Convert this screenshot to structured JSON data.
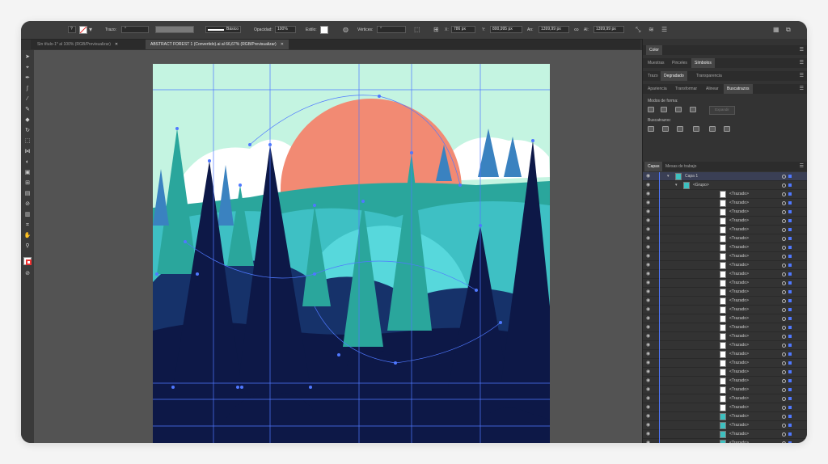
{
  "control_bar": {
    "stroke_label": "Trazo:",
    "brush_label": "Básico",
    "opacity_label": "Opacidad:",
    "opacity_value": "100%",
    "style_label": "Estilo:",
    "vertices_label": "Vértices:",
    "x_value": "786 px",
    "y_value": "800,995 px",
    "w_label": "An:",
    "w_value": "1399,99 px",
    "h_label": "Al:",
    "h_value": "1399,99 px",
    "icons": [
      "group-icon",
      "stroke-swatch-icon",
      "fill-swatch-icon",
      "globe-icon",
      "align-icon",
      "transform-icon",
      "link-icon",
      "isolate-icon",
      "arrange-icon",
      "panel-toggle-icon"
    ]
  },
  "document_tabs": [
    {
      "label": "Sin título-1* al 100% (RGB/Previsualizar)",
      "active": false
    },
    {
      "label": "ABSTRACT FOREST 1 (Convertido).ai al 66,67% (RGB/Previsualizar)",
      "active": true
    }
  ],
  "tools": [
    "selection-tool-icon",
    "direct-selection-tool-icon",
    "pen-tool-icon",
    "curvature-tool-icon",
    "paintbrush-tool-icon",
    "pencil-tool-icon",
    "eraser-tool-icon",
    "rotate-tool-icon",
    "scale-tool-icon",
    "width-tool-icon",
    "shape-builder-tool-icon",
    "perspective-tool-icon",
    "mesh-tool-icon",
    "gradient-tool-icon",
    "eyedropper-tool-icon",
    "chart-tool-icon",
    "artboard-tool-icon",
    "hand-tool-icon",
    "zoom-tool-icon",
    "fill-stroke-icon",
    "swap-colors-icon",
    "color-mode-icon"
  ],
  "panels": {
    "color_title": "Color",
    "row1_tabs": [
      "Muestras",
      "Pinceles",
      "Símbolos"
    ],
    "row1_active": 2,
    "row2_tabs": [
      "Trazo",
      "Degradado",
      "Transparencia"
    ],
    "row2_active": 1,
    "row3_tabs": [
      "Apariencia",
      "Transformar",
      "Alinear",
      "Buscatrazos"
    ],
    "row3_active": 3,
    "shape_modes_label": "Modos de forma:",
    "expand_label": "Expandir",
    "pathfinders_label": "Buscatrazos:",
    "layers_tabs": [
      "Capas",
      "Mesas de trabajo"
    ],
    "layers_active": 0
  },
  "layers": {
    "top": {
      "name": "Capa 1"
    },
    "group": {
      "name": "<Grupo>"
    },
    "items": [
      {
        "name": "<Trazado>",
        "thumb": "white"
      },
      {
        "name": "<Trazado>",
        "thumb": "white"
      },
      {
        "name": "<Trazado>",
        "thumb": "white"
      },
      {
        "name": "<Trazado>",
        "thumb": "white"
      },
      {
        "name": "<Trazado>",
        "thumb": "white"
      },
      {
        "name": "<Trazado>",
        "thumb": "white"
      },
      {
        "name": "<Trazado>",
        "thumb": "white"
      },
      {
        "name": "<Trazado>",
        "thumb": "white"
      },
      {
        "name": "<Trazado>",
        "thumb": "white"
      },
      {
        "name": "<Trazado>",
        "thumb": "white"
      },
      {
        "name": "<Trazado>",
        "thumb": "white"
      },
      {
        "name": "<Trazado>",
        "thumb": "white"
      },
      {
        "name": "<Trazado>",
        "thumb": "white"
      },
      {
        "name": "<Trazado>",
        "thumb": "white"
      },
      {
        "name": "<Trazado>",
        "thumb": "white"
      },
      {
        "name": "<Trazado>",
        "thumb": "white"
      },
      {
        "name": "<Trazado>",
        "thumb": "white"
      },
      {
        "name": "<Trazado>",
        "thumb": "white"
      },
      {
        "name": "<Trazado>",
        "thumb": "white"
      },
      {
        "name": "<Trazado>",
        "thumb": "white"
      },
      {
        "name": "<Trazado>",
        "thumb": "white"
      },
      {
        "name": "<Trazado>",
        "thumb": "white"
      },
      {
        "name": "<Trazado>",
        "thumb": "white"
      },
      {
        "name": "<Trazado>",
        "thumb": "white"
      },
      {
        "name": "<Trazado>",
        "thumb": "white"
      },
      {
        "name": "<Trazado>",
        "thumb": "cyan"
      },
      {
        "name": "<Trazado>",
        "thumb": "cyan"
      },
      {
        "name": "<Trazado>",
        "thumb": "cyan"
      },
      {
        "name": "<Trazado>",
        "thumb": "cyan"
      },
      {
        "name": "<Trazado>",
        "thumb": "white"
      }
    ]
  },
  "colors": {
    "sky": "#c4f4e1",
    "sun": "#f28a73",
    "cloud": "#ffffff",
    "teal": "#2aa69c",
    "turquoise": "#3ec0c4",
    "cyan_light": "#57d8dc",
    "navy": "#0d1847",
    "navy_mid": "#16326a",
    "blue_gray": "#6e8fc0",
    "selection": "#4f78ff"
  }
}
